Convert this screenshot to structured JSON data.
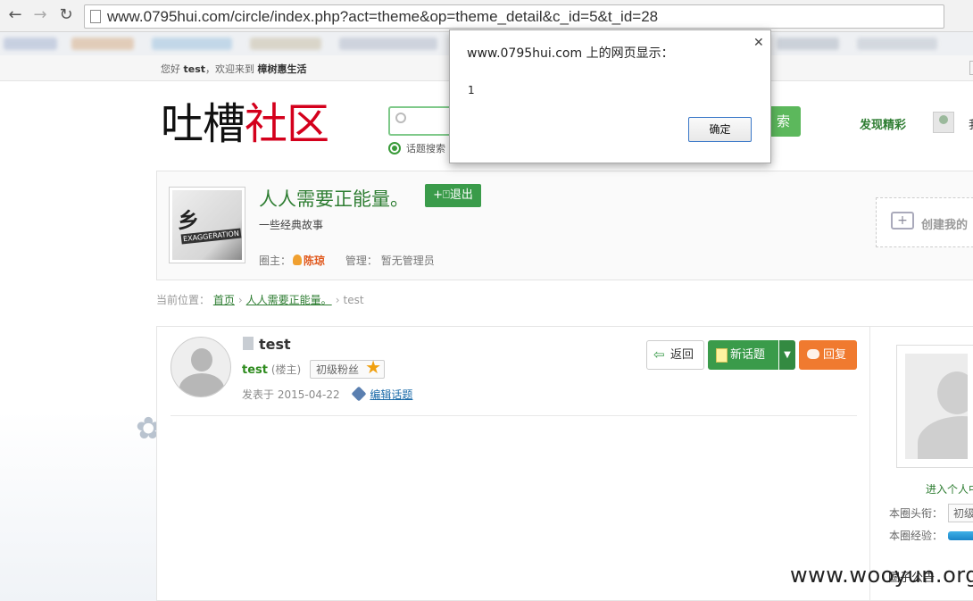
{
  "browser": {
    "url": "www.0795hui.com/circle/index.php?act=theme&op=theme_detail&c_id=5&t_id=28",
    "back_icon": "arrow-left-icon",
    "forward_icon": "arrow-right-icon",
    "reload_icon": "reload-icon"
  },
  "site_top": {
    "greeting": "您好",
    "username": "test",
    "welcome_text": "，欢迎来到",
    "site_name": "樟树惠生活"
  },
  "header": {
    "logo_black": "吐槽",
    "logo_red": "社区",
    "search_button": "索",
    "search_option": "话题搜索",
    "discover": "发现精彩",
    "user_truncated": "我"
  },
  "circle": {
    "name": "人人需要正能量。",
    "quit_button": "+⍞退出",
    "description": "一些经典故事",
    "owner_label": "圈主：",
    "owner_name": "陈琼",
    "manager_label": "管理：",
    "manager_value": "暂无管理员",
    "image_text": "EXAGGERATION",
    "create_label": "创建我的"
  },
  "breadcrumb": {
    "prefix": "当前位置：",
    "home": "首页",
    "circle": "人人需要正能量。",
    "current": "test"
  },
  "post": {
    "title": "test",
    "author": "test",
    "role": "(楼主)",
    "level": "初级粉丝",
    "posted_label": "发表于",
    "date": "2015-04-22",
    "edit_link": "编辑话题",
    "back_button": "返回",
    "new_topic_button": "新话题",
    "reply_button": "回复"
  },
  "profile_panel": {
    "link": "进入个人中",
    "rank_label": "本圈头衔：",
    "rank_value": "初级",
    "exp_label": "本圈经验：",
    "exp_fraction": 1.0,
    "bottom_text": "圈子公告"
  },
  "dialog": {
    "title": "www.0795hui.com 上的网页显示：",
    "message": "1",
    "ok_button": "确定",
    "close_icon": "close-icon"
  },
  "watermark": "www.wooyun.org",
  "colors": {
    "brand_green": "#3a9b4a",
    "brand_red": "#d4001c",
    "reply_orange": "#f07a2f",
    "link_blue": "#1a6aa8"
  }
}
